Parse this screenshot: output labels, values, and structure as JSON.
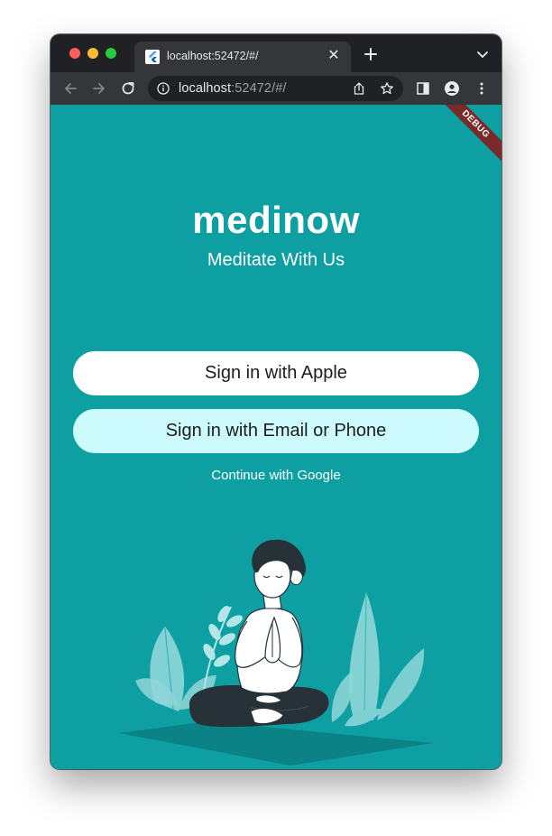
{
  "browser": {
    "tab": {
      "title": "localhost:52472/#/"
    },
    "url": {
      "host": "localhost",
      "rest": ":52472/#/"
    },
    "icons": {
      "favicon": "flutter-logo-icon",
      "close": "close-icon",
      "new_tab": "plus-icon",
      "tab_menu": "chevron-down-icon",
      "back": "arrow-left-icon",
      "forward": "arrow-right-icon",
      "reload": "reload-icon",
      "info": "info-icon",
      "share": "share-icon",
      "bookmark": "star-icon",
      "side_panel": "side-panel-icon",
      "profile": "profile-icon",
      "menu": "kebab-menu-icon"
    }
  },
  "app": {
    "debug_banner": "DEBUG",
    "title": "medinow",
    "subtitle": "Meditate With Us",
    "buttons": {
      "apple": "Sign in with Apple",
      "email": "Sign in with Email or Phone",
      "google": "Continue with Google"
    },
    "illustration": "meditating-person-illustration",
    "colors": {
      "background": "#0e9fa3",
      "primary_button": "#ffffff",
      "secondary_button": "#cdfbfd",
      "text_light": "#ffffff"
    }
  }
}
